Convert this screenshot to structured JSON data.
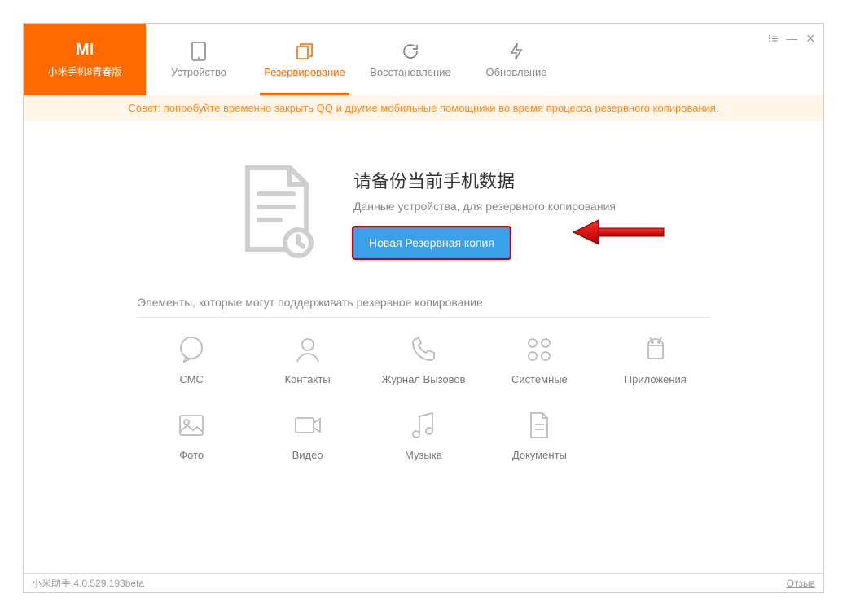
{
  "device": {
    "name": "小米手机8青春版"
  },
  "tabs": {
    "device": "Устройство",
    "backup": "Резервирование",
    "restore": "Восстановление",
    "update": "Обновление"
  },
  "notice": "Совет: попробуйте временно закрыть QQ и другие мобильные помощники во время процесса резервного копирования.",
  "hero": {
    "title": "请备份当前手机数据",
    "subtitle": "Данные устройства, для резервного копирования",
    "button": "Новая Резервная копия"
  },
  "section_label": "Элементы, которые могут поддерживать резервное копирование",
  "categories": {
    "sms": "СМС",
    "contacts": "Контакты",
    "calllog": "Журнал Вызовов",
    "system": "Системные",
    "apps": "Приложения",
    "photo": "Фото",
    "video": "Видео",
    "music": "Музыка",
    "docs": "Документы"
  },
  "status": {
    "version": "小米助手:4.0.529.193beta",
    "feedback": "Отзыв"
  }
}
